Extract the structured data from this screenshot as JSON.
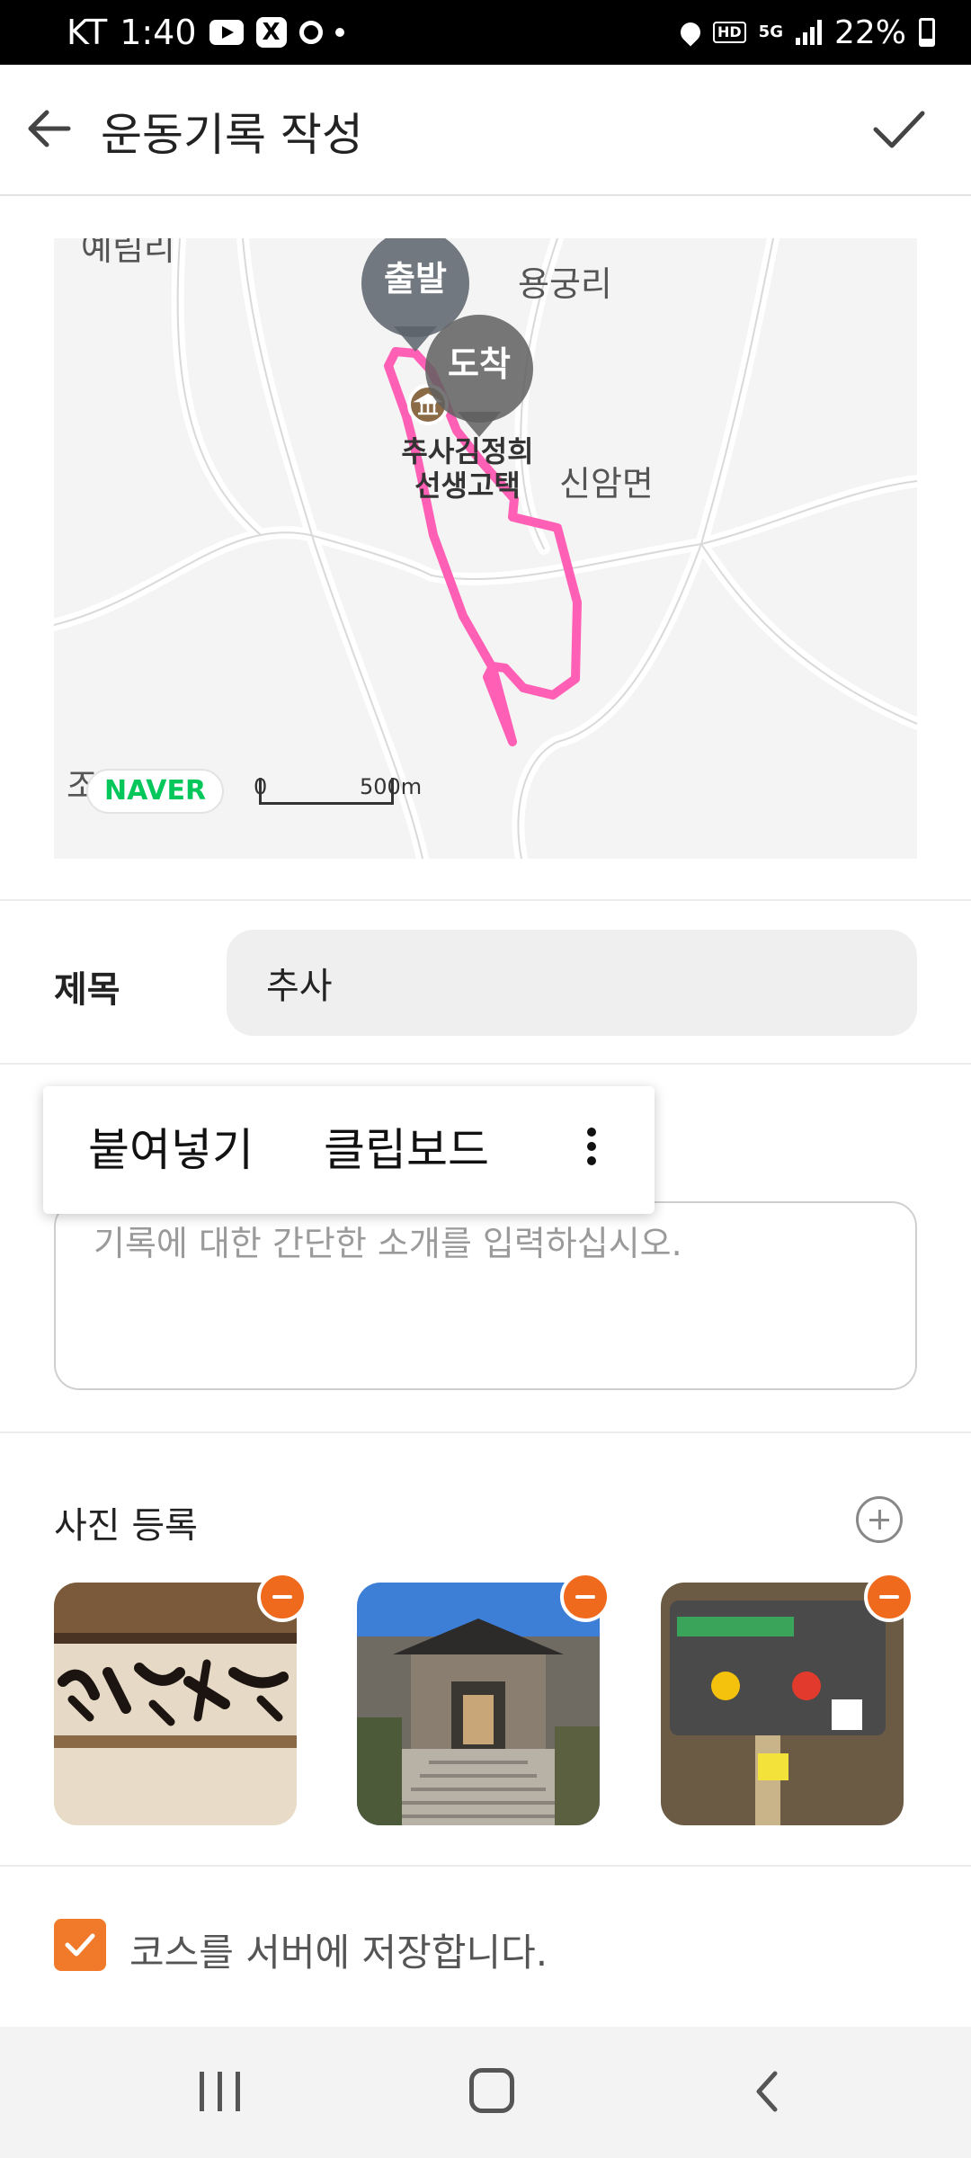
{
  "status_bar": {
    "carrier": "KT",
    "time": "1:40",
    "network_hd": "HD",
    "network_5g": "5G",
    "battery": "22%"
  },
  "app_bar": {
    "title": "운동기록 작성",
    "back_icon": "arrow-left-icon",
    "confirm_icon": "check-icon"
  },
  "map": {
    "places": [
      "예림리",
      "용궁리",
      "신암면",
      "조금리"
    ],
    "poi_name_line1": "추사김정희",
    "poi_name_line2": "선생고택",
    "start_marker": "출발",
    "end_marker": "도착",
    "provider_logo": "NAVER",
    "scale_start": "0",
    "scale_end": "500m",
    "route_color": "#ff5fb4"
  },
  "form": {
    "title_label": "제목",
    "title_value": "추사",
    "description_placeholder": "기록에 대한 간단한 소개를 입력하십시오."
  },
  "paste_popup": {
    "paste_label": "붙여넣기",
    "clipboard_label": "클립보드",
    "more_icon": "more-vertical-icon"
  },
  "photos": {
    "section_title": "사진 등록",
    "add_icon": "plus-circle-icon",
    "items": [
      {
        "kind": "calligraphy-signboard"
      },
      {
        "kind": "traditional-gate"
      },
      {
        "kind": "trail-sign"
      }
    ]
  },
  "save_course": {
    "checked": true,
    "label": "코스를 서버에 저장합니다."
  },
  "colors": {
    "accent": "#f06a1e",
    "checkbox": "#f07a2a",
    "marker_gray": "#6e7378"
  }
}
